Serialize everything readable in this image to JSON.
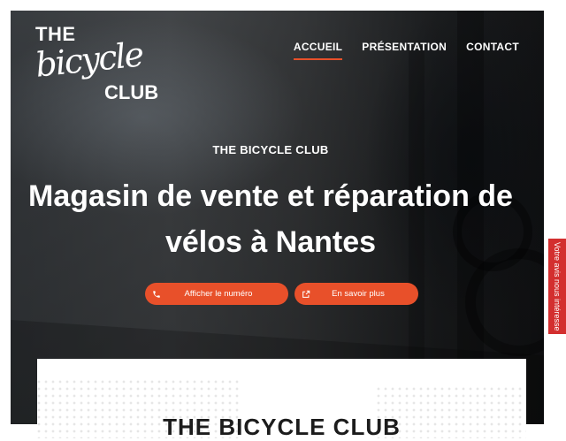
{
  "brand": {
    "logo_text": "THE bicycle CLUB",
    "logo_the": "THE",
    "logo_bicycle": "bicycle",
    "logo_club": "CLUB"
  },
  "nav": {
    "items": [
      {
        "label": "ACCUEIL",
        "active": true
      },
      {
        "label": "PRÉSENTATION",
        "active": false
      },
      {
        "label": "CONTACT",
        "active": false
      }
    ]
  },
  "hero": {
    "eyebrow": "THE BICYCLE CLUB",
    "headline_line1": "Magasin de vente et réparation de",
    "headline_line2": "vélos à Nantes",
    "buttons": {
      "phone": {
        "label": "Afficher le numéro",
        "icon": "phone-icon"
      },
      "more": {
        "label": "En savoir plus",
        "icon": "external-link-icon"
      }
    }
  },
  "card": {
    "title": "THE BICYCLE CLUB"
  },
  "feedback": {
    "label": "Votre avis nous intéresse"
  },
  "colors": {
    "accent": "#e8502a",
    "feedback": "#d32f2f",
    "text_light": "#ffffff"
  }
}
